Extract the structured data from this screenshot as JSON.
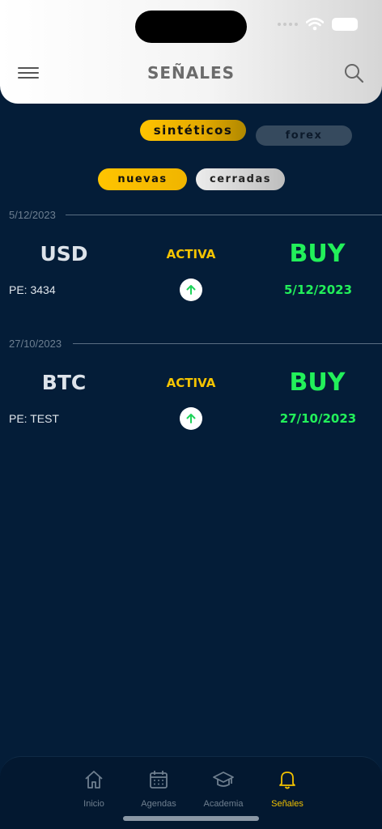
{
  "header": {
    "title": "SEÑALES"
  },
  "filters": {
    "market": [
      {
        "label": "sintéticos",
        "active": true
      },
      {
        "label": "forex",
        "active": false
      }
    ],
    "status": [
      {
        "label": "nuevas",
        "active": true
      },
      {
        "label": "cerradas",
        "active": false
      }
    ]
  },
  "signals": [
    {
      "group_date": "5/12/2023",
      "symbol": "USD",
      "state": "ACTIVA",
      "side": "BUY",
      "pe": "PE: 3434",
      "date": "5/12/2023"
    },
    {
      "group_date": "27/10/2023",
      "symbol": "BTC",
      "state": "ACTIVA",
      "side": "BUY",
      "pe": "PE: TEST",
      "date": "27/10/2023"
    }
  ],
  "tabs": [
    {
      "label": "Inicio",
      "icon": "home-icon"
    },
    {
      "label": "Agendas",
      "icon": "calendar-icon"
    },
    {
      "label": "Academia",
      "icon": "graduation-cap-icon"
    },
    {
      "label": "Señales",
      "icon": "bell-icon",
      "active": true
    }
  ],
  "colors": {
    "accent": "#f5c400",
    "buy": "#22f05a",
    "background": "#041d38"
  }
}
